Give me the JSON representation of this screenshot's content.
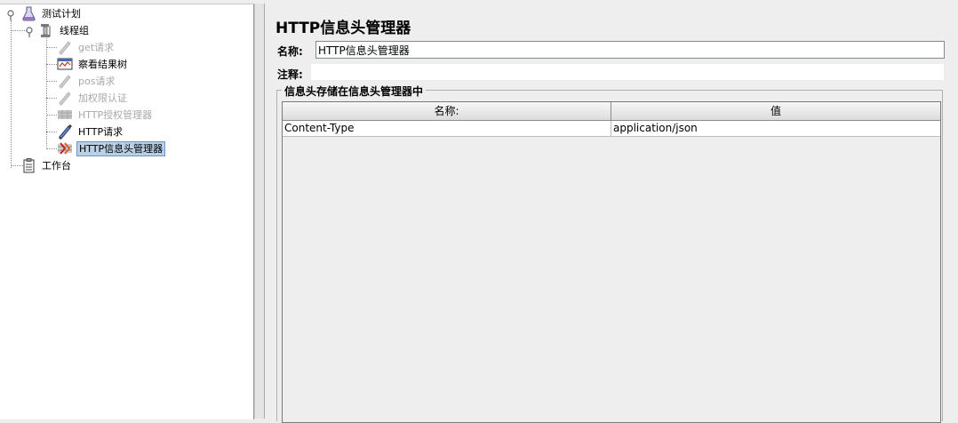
{
  "tree": {
    "nodes": [
      {
        "label": "测试计划",
        "icon": "test-plan-icon",
        "state": "normal"
      },
      {
        "label": "线程组",
        "icon": "thread-group-icon",
        "state": "normal"
      },
      {
        "label": "get请求",
        "icon": "http-sampler-icon",
        "state": "disabled"
      },
      {
        "label": "察看结果树",
        "icon": "result-tree-icon",
        "state": "normal"
      },
      {
        "label": "pos请求",
        "icon": "http-sampler-icon",
        "state": "disabled"
      },
      {
        "label": "加权限认证",
        "icon": "http-sampler-icon",
        "state": "disabled"
      },
      {
        "label": "HTTP授权管理器",
        "icon": "auth-manager-icon",
        "state": "disabled"
      },
      {
        "label": "HTTP请求",
        "icon": "http-sampler-icon",
        "state": "normal"
      },
      {
        "label": "HTTP信息头管理器",
        "icon": "header-manager-icon",
        "state": "selected"
      },
      {
        "label": "工作台",
        "icon": "workbench-icon",
        "state": "normal"
      }
    ]
  },
  "panel": {
    "title": "HTTP信息头管理器",
    "name_label": "名称:",
    "name_value": "HTTP信息头管理器",
    "comment_label": "注释:",
    "comment_value": "",
    "group_title": "信息头存储在信息头管理器中"
  },
  "headers_table": {
    "columns": [
      "名称:",
      "值"
    ],
    "rows": [
      [
        "Content-Type",
        "application/json"
      ]
    ]
  },
  "colors": {
    "selection": "#b8cfe5",
    "disabled_text": "#a8a8a8",
    "background": "#eeeeee"
  }
}
